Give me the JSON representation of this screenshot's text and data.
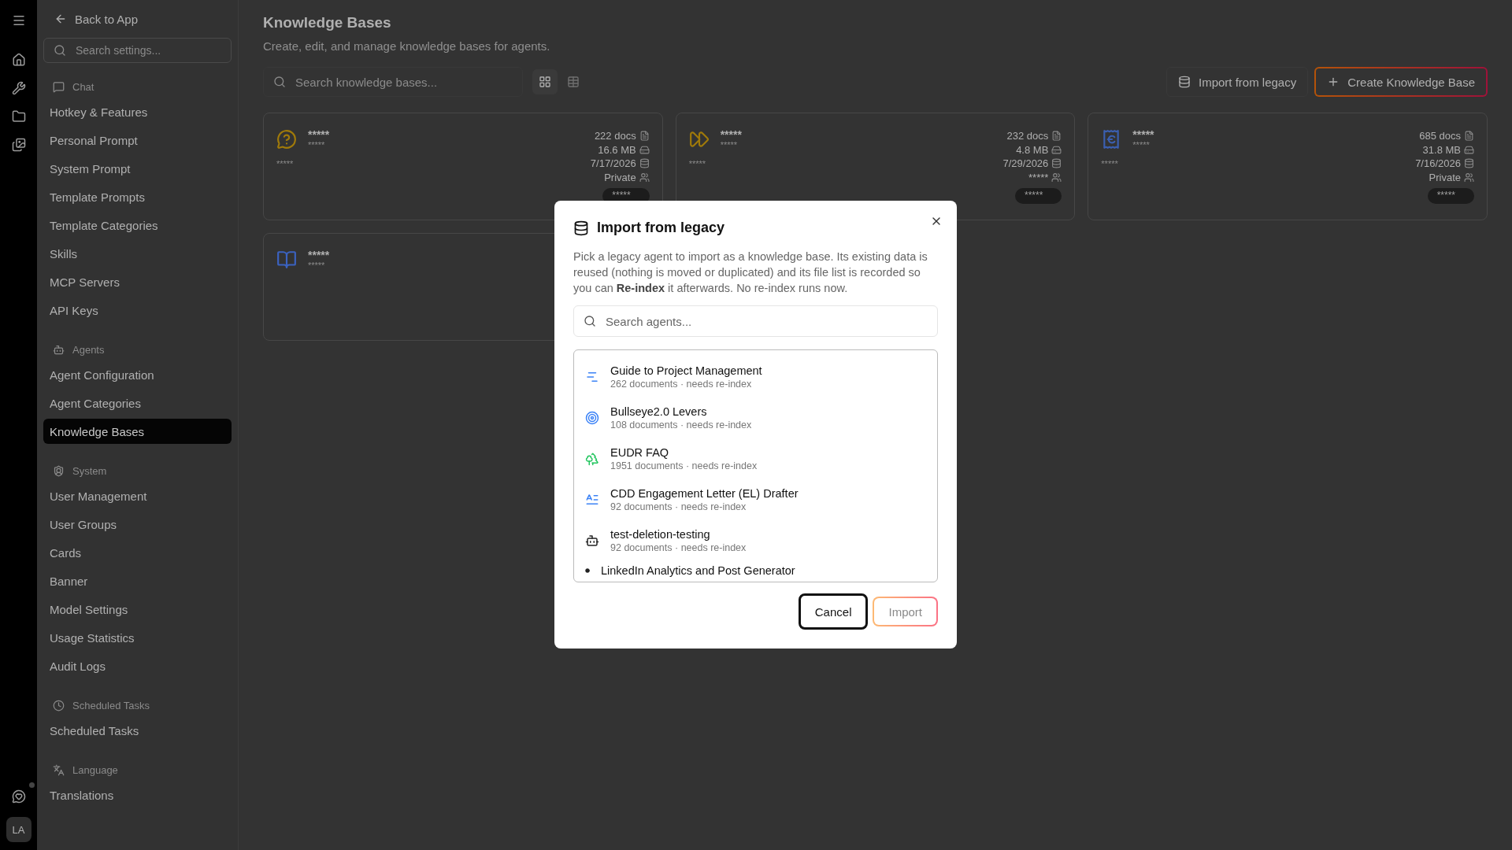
{
  "rail": {
    "avatar": "LA"
  },
  "sidebar": {
    "back": "Back to App",
    "search": {
      "placeholder": "Search settings..."
    },
    "sections": [
      {
        "title": "Chat",
        "items": [
          {
            "label": "Hotkey & Features",
            "selected": false
          },
          {
            "label": "Personal Prompt",
            "selected": false
          },
          {
            "label": "System Prompt",
            "selected": false
          },
          {
            "label": "Template Prompts",
            "selected": false
          },
          {
            "label": "Template Categories",
            "selected": false
          },
          {
            "label": "Skills",
            "selected": false
          },
          {
            "label": "MCP Servers",
            "selected": false
          },
          {
            "label": "API Keys",
            "selected": false
          }
        ]
      },
      {
        "title": "Agents",
        "items": [
          {
            "label": "Agent Configuration",
            "selected": false
          },
          {
            "label": "Agent Categories",
            "selected": false
          },
          {
            "label": "Knowledge Bases",
            "selected": true
          }
        ]
      },
      {
        "title": "System",
        "items": [
          {
            "label": "User Management",
            "selected": false
          },
          {
            "label": "User Groups",
            "selected": false
          },
          {
            "label": "Cards",
            "selected": false
          },
          {
            "label": "Banner",
            "selected": false
          },
          {
            "label": "Model Settings",
            "selected": false
          },
          {
            "label": "Usage Statistics",
            "selected": false
          },
          {
            "label": "Audit Logs",
            "selected": false
          }
        ]
      },
      {
        "title": "Scheduled Tasks",
        "items": [
          {
            "label": "Scheduled Tasks",
            "selected": false
          }
        ]
      },
      {
        "title": "Language",
        "items": [
          {
            "label": "Translations",
            "selected": false
          }
        ]
      }
    ]
  },
  "page": {
    "title": "Knowledge Bases",
    "subtitle": "Create, edit, and manage knowledge bases for agents.",
    "search": {
      "placeholder": "Search knowledge bases..."
    },
    "views": [
      {
        "kind": "grid",
        "selected": true
      },
      {
        "kind": "table",
        "selected": false
      }
    ],
    "buttons": {
      "import": "Import from legacy",
      "create": "Create Knowledge Base"
    },
    "cards": [
      {
        "title": "*****",
        "subtitle": "*****",
        "description": "*****",
        "stats": [
          "222 docs",
          "16.6 MB",
          "7/17/2026",
          "Private"
        ],
        "pill": "*****"
      },
      {
        "title": "*****",
        "subtitle": "*****",
        "description": "*****",
        "stats": [
          "232 docs",
          "4.8 MB",
          "7/29/2026",
          "*****"
        ],
        "pill": "*****"
      },
      {
        "title": "*****",
        "subtitle": "*****",
        "description": "*****",
        "stats": [
          "685 docs",
          "31.8 MB",
          "7/16/2026",
          "Private"
        ],
        "pill": "*****"
      },
      {
        "title": "*****",
        "subtitle": "*****"
      }
    ]
  },
  "dialog": {
    "title": "Import from legacy",
    "description": "Pick a legacy agent to import as a knowledge base. Its existing data is reused (nothing is moved or duplicated) and its file list is recorded so you can **Re-index** it afterwards. No re-index runs now.",
    "search": {
      "placeholder": "Search agents..."
    },
    "agents": [
      {
        "name": "Guide to Project Management",
        "meta": "262 documents · needs re-index"
      },
      {
        "name": "Bullseye2.0 Levers",
        "meta": "108 documents · needs re-index"
      },
      {
        "name": "EUDR FAQ",
        "meta": "1951 documents · needs re-index"
      },
      {
        "name": "CDD Engagement Letter (EL) Drafter",
        "meta": "92 documents · needs re-index"
      },
      {
        "name": "test-deletion-testing",
        "meta": "92 documents · needs re-index"
      },
      {
        "name": "LinkedIn Analytics and Post Generator"
      }
    ],
    "buttons": [
      {
        "label": "Cancel",
        "kind": "cancel",
        "disabled": false
      },
      {
        "label": "Import",
        "kind": "primary",
        "disabled": true
      }
    ]
  }
}
